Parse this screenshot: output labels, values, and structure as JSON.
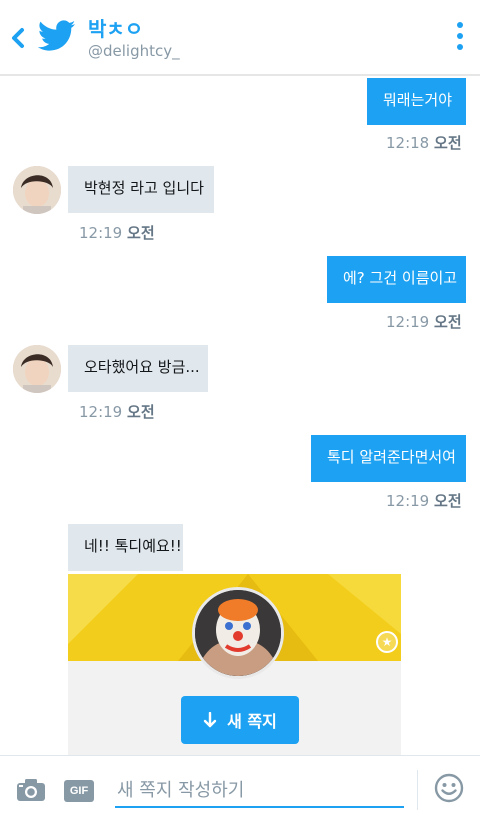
{
  "header": {
    "title": "박ㅊㅇ",
    "handle": "@delightcy_"
  },
  "messages": [
    {
      "text": "뭐래는거야",
      "time": "12:18",
      "ampm": "오전"
    },
    {
      "text": "박현정 라고 입니다",
      "time": "12:19",
      "ampm": "오전"
    },
    {
      "text": "에? 그건 이름이고",
      "time": "12:19",
      "ampm": "오전"
    },
    {
      "text": "오타했어요 방금...",
      "time": "12:19",
      "ampm": "오전"
    },
    {
      "text": "톡디 알려준다면서여",
      "time": "12:19",
      "ampm": "오전"
    },
    {
      "text": "네!! 톡디예요!!"
    }
  ],
  "card": {
    "button_label": "새 쪽지"
  },
  "composer": {
    "placeholder": "새 쪽지 작성하기",
    "gif_label": "GIF"
  },
  "colors": {
    "accent": "#1da1f2",
    "incoming_bubble": "#e1e8ed",
    "banner": "#f3cd1b"
  },
  "icons": [
    "back-arrow-icon",
    "twitter-bird-icon",
    "more-vert-icon",
    "camera-icon",
    "gif-icon",
    "emoji-icon",
    "star-icon",
    "arrow-down-icon"
  ]
}
